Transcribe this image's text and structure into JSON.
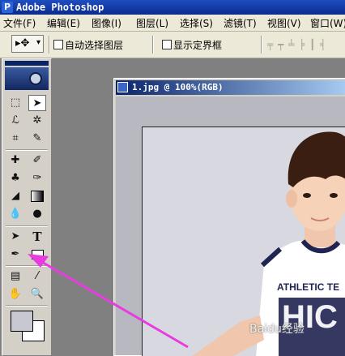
{
  "app": {
    "title": "Adobe Photoshop"
  },
  "menu": [
    {
      "label": "文件(F)"
    },
    {
      "label": "编辑(E)"
    },
    {
      "label": "图像(I)"
    },
    {
      "label": "图层(L)"
    },
    {
      "label": "选择(S)"
    },
    {
      "label": "滤镜(T)"
    },
    {
      "label": "视图(V)"
    },
    {
      "label": "窗口(W)"
    }
  ],
  "options": {
    "auto_select_layer": "自动选择图层",
    "show_bounding_box": "显示定界框",
    "auto_select_checked": false,
    "bounding_box_checked": false
  },
  "document": {
    "title": "1.jpg @ 100%(RGB)"
  },
  "photo": {
    "shirt_text_top": "ATHLETIC TE",
    "shirt_text_big": "HIC",
    "watermark": "Baidu经验"
  },
  "colors": {
    "arrow": "#e83ce0",
    "foreground": "#c7c8d2",
    "background": "#ffffff"
  },
  "icons": [
    "move-icon",
    "marquee-icon",
    "lasso-icon",
    "magic-wand-icon",
    "crop-icon",
    "slice-icon",
    "healing-icon",
    "brush-icon",
    "stamp-icon",
    "history-brush-icon",
    "eraser-icon",
    "gradient-icon",
    "blur-icon",
    "dodge-icon",
    "path-select-icon",
    "type-icon",
    "pen-icon",
    "shape-icon",
    "notes-icon",
    "eyedropper-icon",
    "hand-icon",
    "zoom-icon"
  ]
}
